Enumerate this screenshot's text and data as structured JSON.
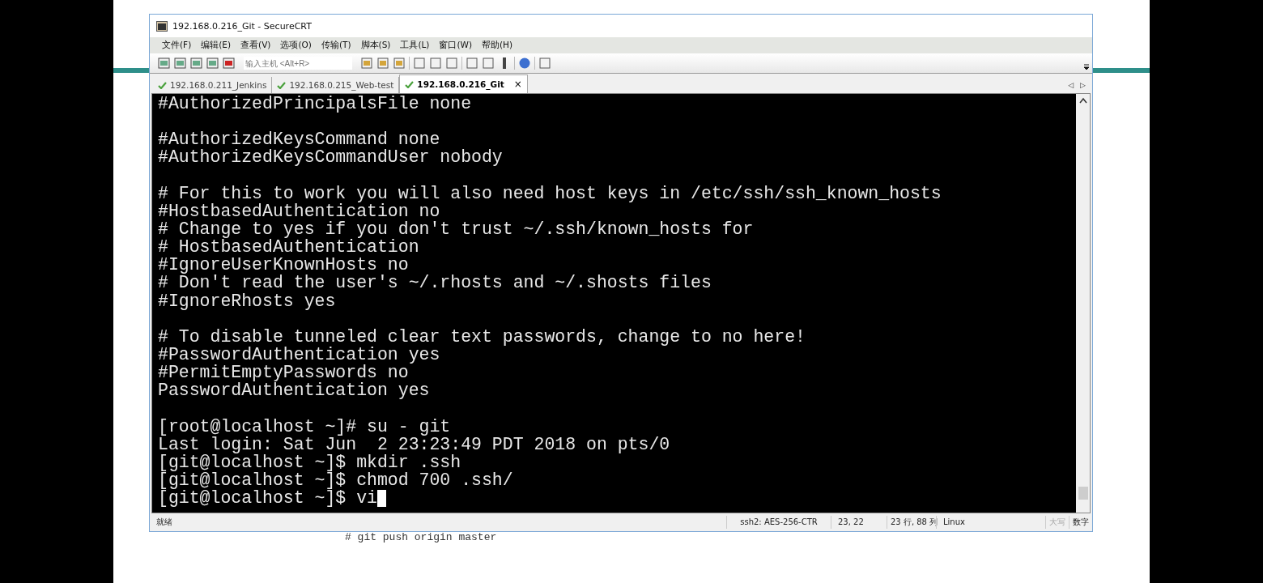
{
  "window": {
    "title": "192.168.0.216_Git - SecureCRT"
  },
  "menu": [
    "文件(F)",
    "编辑(E)",
    "查看(V)",
    "选项(O)",
    "传输(T)",
    "脚本(S)",
    "工具(L)",
    "窗口(W)",
    "帮助(H)"
  ],
  "toolbar": {
    "host_field": {
      "placeholder": "输入主机 <Alt+R>"
    }
  },
  "tabs": [
    {
      "label": "192.168.0.211_Jenkins",
      "selected": false
    },
    {
      "label": "192.168.0.215_Web-test",
      "selected": false
    },
    {
      "label": "192.168.0.216_Git",
      "selected": true,
      "close": "×"
    }
  ],
  "tab_scroll": [
    "◁",
    "▷"
  ],
  "terminal": {
    "blocks": [
      [
        "#AuthorizedPrincipalsFile none"
      ],
      [
        "#AuthorizedKeysCommand none",
        "#AuthorizedKeysCommandUser nobody"
      ],
      [
        "# For this to work you will also need host keys in /etc/ssh/ssh_known_hosts",
        "#HostbasedAuthentication no",
        "# Change to yes if you don't trust ~/.ssh/known_hosts for",
        "# HostbasedAuthentication",
        "#IgnoreUserKnownHosts no",
        "# Don't read the user's ~/.rhosts and ~/.shosts files",
        "#IgnoreRhosts yes"
      ],
      [
        "# To disable tunneled clear text passwords, change to no here!",
        "#PasswordAuthentication yes",
        "#PermitEmptyPasswords no",
        "PasswordAuthentication yes"
      ],
      [
        "[root@localhost ~]# su - git",
        "Last login: Sat Jun  2 23:23:49 PDT 2018 on pts/0",
        "[git@localhost ~]$ mkdir .ssh",
        "[git@localhost ~]$ chmod 700 .ssh/",
        "[git@localhost ~]$ vi"
      ]
    ]
  },
  "status_bar": {
    "message": "就绪",
    "cipher": "ssh2: AES-256-CTR",
    "cursor_pos": "23,  22",
    "size": "23 行, 88 列",
    "os": "Linux",
    "indicators": [
      {
        "label": "大写",
        "on": false
      },
      {
        "label": "数字",
        "on": true
      }
    ]
  },
  "background_doc": {
    "line": "# git push origin master"
  }
}
